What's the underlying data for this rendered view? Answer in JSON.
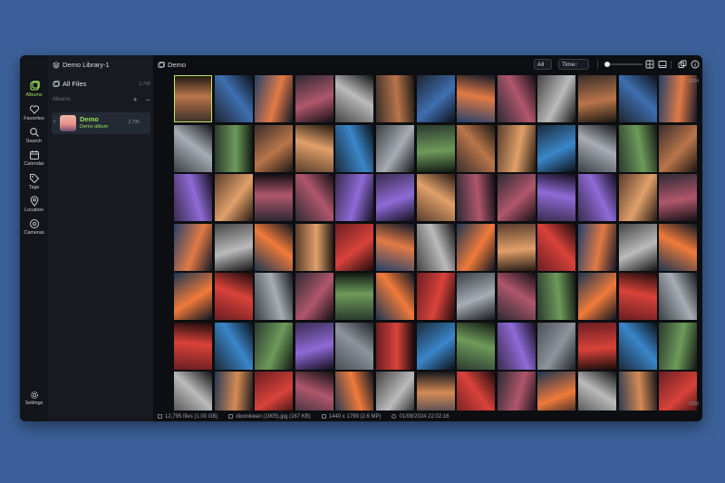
{
  "rail": {
    "items": [
      {
        "label": "Albums",
        "icon": "albums-icon",
        "active": true
      },
      {
        "label": "Favorites",
        "icon": "heart-icon"
      },
      {
        "label": "Search",
        "icon": "search-icon"
      },
      {
        "label": "Calendar",
        "icon": "calendar-icon"
      },
      {
        "label": "Tags",
        "icon": "tag-icon"
      },
      {
        "label": "Location",
        "icon": "location-icon"
      },
      {
        "label": "Cameras",
        "icon": "camera-icon"
      }
    ],
    "settings_label": "Settings"
  },
  "sidebar": {
    "library_title": "Demo Library-1",
    "all_files_label": "All Files",
    "all_files_count": "2,795",
    "albums_header": "Albums",
    "album": {
      "name": "Demo",
      "subtitle": "Demo album",
      "count": "2,795"
    }
  },
  "toolbar": {
    "breadcrumb": "Demo",
    "filter_value": "All",
    "sort_value": "Time↑"
  },
  "timeline": {
    "top_label": "2024",
    "bottom_label": "2026"
  },
  "status": {
    "files": "12,795 files (1.00 GB)",
    "selected_file": "dixonkwan (1905).jpg (167 KB)",
    "dimensions": "1440 x 1799 (2.6 MP)",
    "date": "01/09/2024 22:02:16"
  },
  "colors": {
    "accent": "#9be15d",
    "desktop": "#3c619a",
    "window": "#0c0e11"
  }
}
